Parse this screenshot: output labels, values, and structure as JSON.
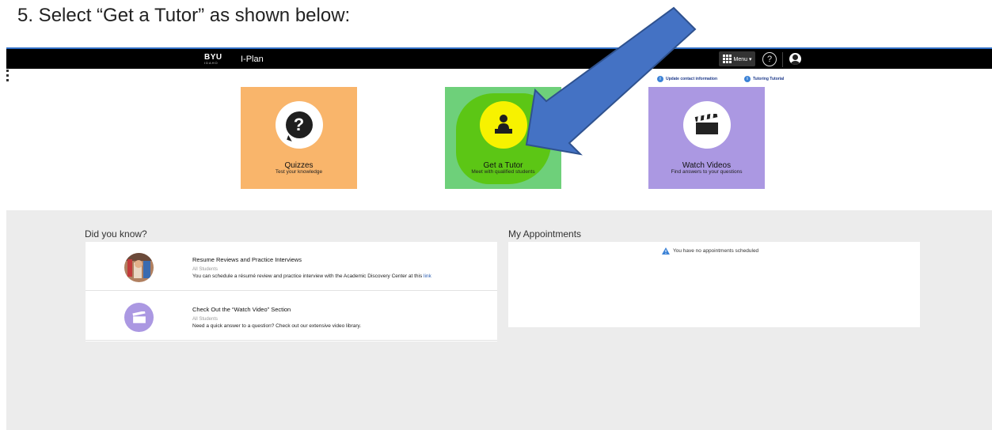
{
  "instruction": "5.   Select “Get a Tutor” as shown below:",
  "topbar": {
    "logo_main": "BYU",
    "logo_sub": "IDAHO",
    "app_title": "I-Plan",
    "menu_label": "Menu ▾",
    "help_glyph": "?"
  },
  "links": {
    "update_contact": "Update contact information",
    "tutoring_tutorial": "Tutoring Tutorial"
  },
  "tiles": [
    {
      "title": "Quizzes",
      "subtitle": "Test your knowledge",
      "color": "#f9b56b",
      "icon": "question-bubble-icon"
    },
    {
      "title": "Get a Tutor",
      "subtitle": "Meet with qualified students",
      "color": "#6ed07a",
      "icon": "tutor-icon"
    },
    {
      "title": "Watch Videos",
      "subtitle": "Find answers to your questions",
      "color": "#ab98e2",
      "icon": "clapperboard-icon"
    }
  ],
  "did_you_know": {
    "heading": "Did you know?",
    "items": [
      {
        "title": "Resume Reviews and Practice Interviews",
        "audience": "All Students",
        "description": "You can schedule a résumé review and practice interview with the Academic Discovery Center at this ",
        "link": "link"
      },
      {
        "title": "Check Out the “Watch Video” Section",
        "audience": "All Students",
        "description": "Need a quick answer to a question? Check out our extensive video library."
      }
    ]
  },
  "appointments": {
    "heading": "My Appointments",
    "empty_message": "You have no appointments scheduled"
  },
  "colors": {
    "accent_blue": "#4472c4",
    "topbar": "#000000",
    "highlight_green": "#5cc615",
    "highlight_yellow": "#f7f200"
  }
}
